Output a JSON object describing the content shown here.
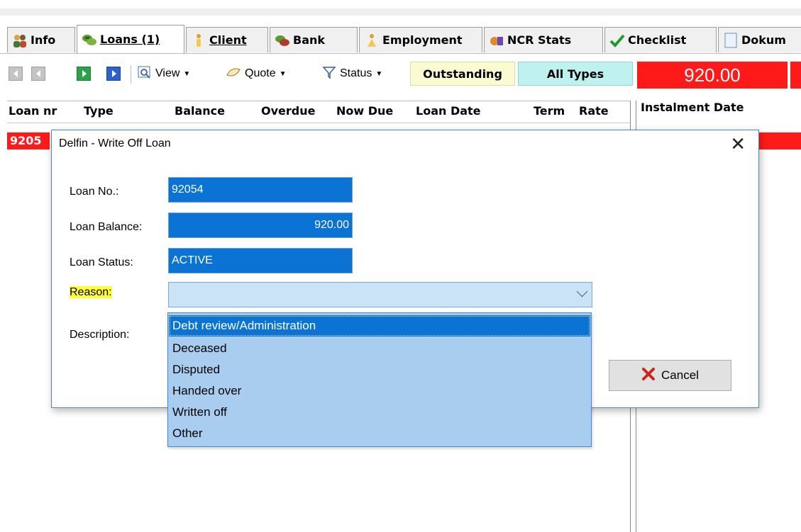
{
  "tabs": [
    {
      "label": "Info",
      "icon": "info-people-icon"
    },
    {
      "label": "Loans (1)",
      "icon": "loans-icon"
    },
    {
      "label": "Client",
      "icon": "client-icon"
    },
    {
      "label": "Bank",
      "icon": "bank-icon"
    },
    {
      "label": "Employment",
      "icon": "employment-icon"
    },
    {
      "label": "NCR Stats",
      "icon": "ncr-stats-icon"
    },
    {
      "label": "Checklist",
      "icon": "checkmark-icon"
    },
    {
      "label": "Dokum",
      "icon": "document-icon"
    }
  ],
  "toolbar": {
    "view_label": "View",
    "quote_label": "Quote",
    "status_label": "Status",
    "outstanding_label": "Outstanding",
    "all_types_label": "All Types",
    "amount": "920.00"
  },
  "grid": {
    "columns": [
      "Loan nr",
      "Type",
      "Balance",
      "Overdue",
      "Now Due",
      "Loan Date",
      "Term",
      "Rate"
    ],
    "rows": [
      {
        "loan_nr": "9205"
      }
    ]
  },
  "right_panel": {
    "header": "Instalment Date"
  },
  "dialog": {
    "title": "Delfin - Write Off Loan",
    "close_glyph": "✕",
    "loan_no_label": "Loan No.:",
    "loan_no": "92054",
    "loan_balance_label": "Loan Balance:",
    "loan_balance": "920.00",
    "loan_status_label": "Loan Status:",
    "loan_status": "ACTIVE",
    "reason_label": "Reason:",
    "reason_value": "",
    "description_label": "Description:",
    "cancel_label": "Cancel"
  },
  "reason_options": [
    "Debt review/Administration",
    "Deceased",
    "Disputed",
    "Handed over",
    "Written off",
    "Other"
  ],
  "colors": {
    "accent_red": "#ff1a1a",
    "selection_blue": "#0a73d4",
    "dropdown_bg": "#a9cdef",
    "highlight_yellow": "#ffff33"
  }
}
